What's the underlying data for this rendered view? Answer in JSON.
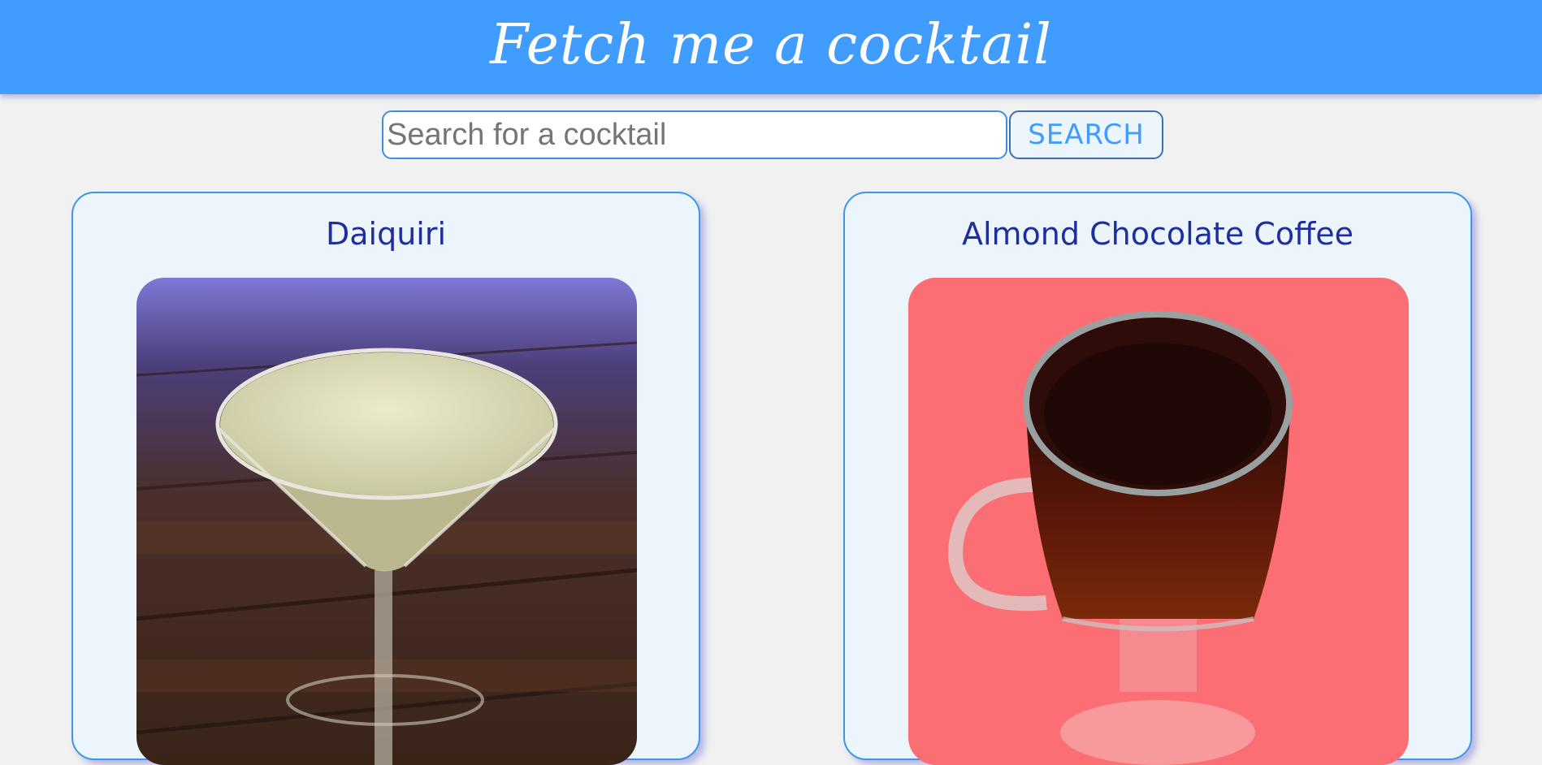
{
  "header": {
    "title": "Fetch me a cocktail"
  },
  "search": {
    "placeholder": "Search for a cocktail",
    "value": "",
    "button_label": "SEARCH"
  },
  "cocktails": [
    {
      "name": "Daiquiri",
      "image": "daiquiri-photo"
    },
    {
      "name": "Almond Chocolate Coffee",
      "image": "almond-chocolate-coffee-photo"
    }
  ],
  "colors": {
    "brand": "#409dff",
    "card_border": "#3c97ec",
    "card_title": "#1d2f9e",
    "background": "#f1f1f1"
  }
}
